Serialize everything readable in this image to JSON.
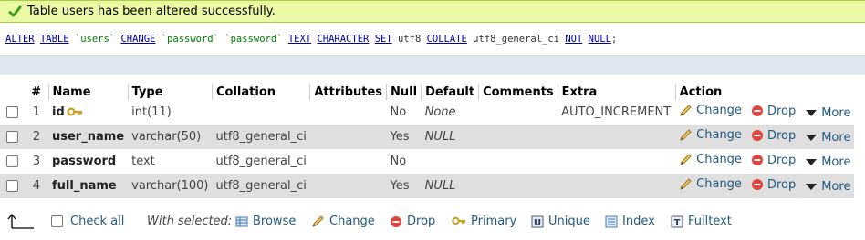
{
  "success": {
    "message": "Table users has been altered successfully."
  },
  "sql": {
    "tokens": [
      {
        "t": "ALTER",
        "k": "kw"
      },
      {
        "t": " ",
        "k": "pl"
      },
      {
        "t": "TABLE",
        "k": "kw"
      },
      {
        "t": " ",
        "k": "pl"
      },
      {
        "t": "`users`",
        "k": "bt"
      },
      {
        "t": " ",
        "k": "pl"
      },
      {
        "t": "CHANGE",
        "k": "kw"
      },
      {
        "t": " ",
        "k": "pl"
      },
      {
        "t": "`password`",
        "k": "bt"
      },
      {
        "t": " ",
        "k": "pl"
      },
      {
        "t": "`password`",
        "k": "bt"
      },
      {
        "t": " ",
        "k": "pl"
      },
      {
        "t": "TEXT",
        "k": "kw"
      },
      {
        "t": " ",
        "k": "pl"
      },
      {
        "t": "CHARACTER",
        "k": "kw"
      },
      {
        "t": " ",
        "k": "pl"
      },
      {
        "t": "SET",
        "k": "kw"
      },
      {
        "t": " utf8 ",
        "k": "pl"
      },
      {
        "t": "COLLATE",
        "k": "kw"
      },
      {
        "t": " utf8_general_ci ",
        "k": "pl"
      },
      {
        "t": "NOT",
        "k": "kw"
      },
      {
        "t": " ",
        "k": "pl"
      },
      {
        "t": "NULL",
        "k": "kw"
      },
      {
        "t": ";",
        "k": "pl"
      }
    ]
  },
  "table": {
    "headers": [
      "#",
      "Name",
      "Type",
      "Collation",
      "Attributes",
      "Null",
      "Default",
      "Comments",
      "Extra",
      "Action"
    ],
    "rows": [
      {
        "num": "1",
        "name": "id",
        "primary_key": true,
        "type": "int(11)",
        "collation": "",
        "attributes": "",
        "null": "No",
        "default": "None",
        "comments": "",
        "extra": "AUTO_INCREMENT"
      },
      {
        "num": "2",
        "name": "user_name",
        "primary_key": false,
        "type": "varchar(50)",
        "collation": "utf8_general_ci",
        "attributes": "",
        "null": "Yes",
        "default": "NULL",
        "comments": "",
        "extra": ""
      },
      {
        "num": "3",
        "name": "password",
        "primary_key": false,
        "type": "text",
        "collation": "utf8_general_ci",
        "attributes": "",
        "null": "No",
        "default": "",
        "comments": "",
        "extra": ""
      },
      {
        "num": "4",
        "name": "full_name",
        "primary_key": false,
        "type": "varchar(100)",
        "collation": "utf8_general_ci",
        "attributes": "",
        "null": "Yes",
        "default": "NULL",
        "comments": "",
        "extra": ""
      }
    ],
    "row_actions": {
      "change": "Change",
      "drop": "Drop",
      "more": "More"
    }
  },
  "footer": {
    "check_all": "Check all",
    "with_selected": "With selected:",
    "buttons": {
      "browse": "Browse",
      "change": "Change",
      "drop": "Drop",
      "primary": "Primary",
      "unique": "Unique",
      "index": "Index",
      "fulltext": "Fulltext"
    }
  },
  "colors": {
    "success_bg": "#ebf8a4",
    "row_even": "#dfdfdf",
    "link": "#235a81",
    "sql_keyword": "#0000a0",
    "sql_backtick": "#008000"
  }
}
